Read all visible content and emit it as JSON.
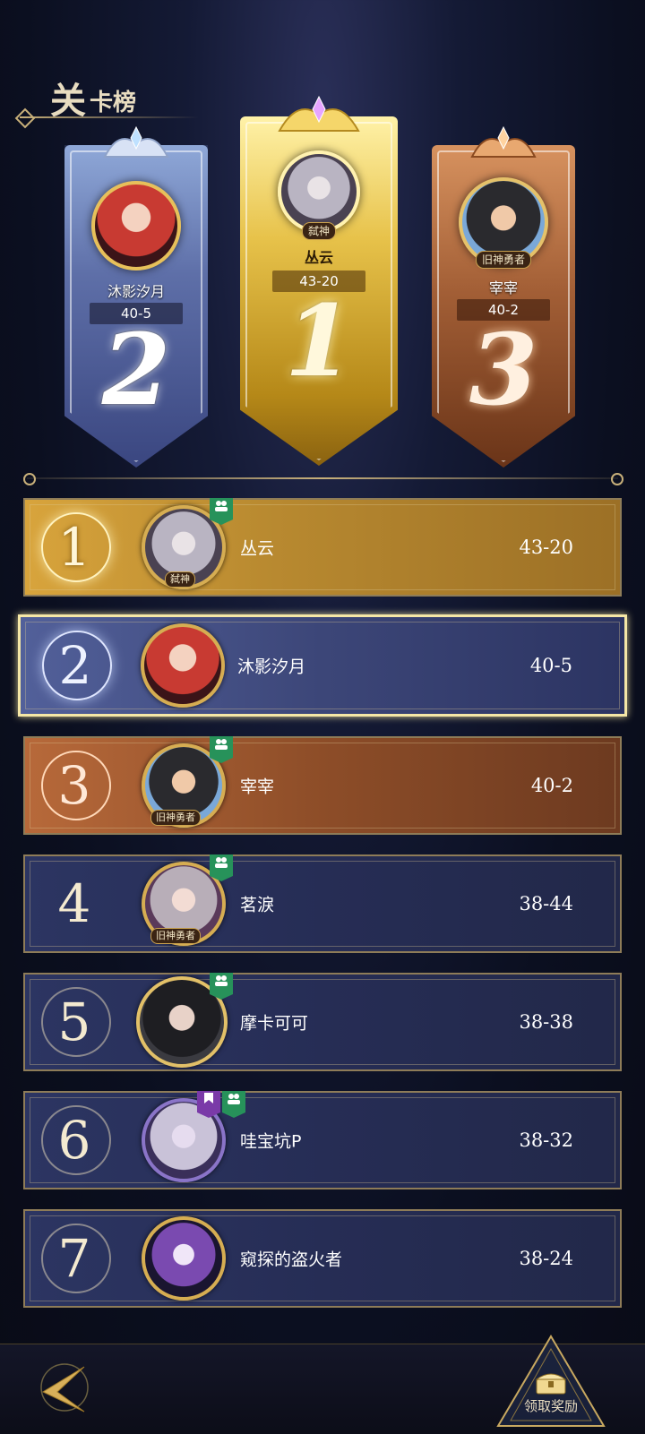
{
  "header": {
    "title_big": "关",
    "title_small": "卡榜"
  },
  "podium": [
    {
      "rank": "2",
      "name": "沐影汐月",
      "score": "40-5",
      "tag": ""
    },
    {
      "rank": "1",
      "name": "丛云",
      "score": "43-20",
      "tag": "弑神"
    },
    {
      "rank": "3",
      "name": "宰宰",
      "score": "40-2",
      "tag": "旧神勇者"
    }
  ],
  "rows": [
    {
      "rank": "1",
      "name": "丛云",
      "score": "43-20",
      "tag": "弑神",
      "badges": [
        "green"
      ]
    },
    {
      "rank": "2",
      "name": "沐影汐月",
      "score": "40-5",
      "tag": "",
      "badges": []
    },
    {
      "rank": "3",
      "name": "宰宰",
      "score": "40-2",
      "tag": "旧神勇者",
      "badges": [
        "green"
      ]
    },
    {
      "rank": "4",
      "name": "茗淚",
      "score": "38-44",
      "tag": "旧神勇者",
      "badges": [
        "green"
      ]
    },
    {
      "rank": "5",
      "name": "摩卡可可",
      "score": "38-38",
      "tag": "",
      "badges": [
        "green"
      ]
    },
    {
      "rank": "6",
      "name": "哇宝坑P",
      "score": "38-32",
      "tag": "",
      "badges": [
        "purple",
        "green"
      ]
    },
    {
      "rank": "7",
      "name": "窥探的盗火者",
      "score": "38-24",
      "tag": "",
      "badges": []
    }
  ],
  "footer": {
    "reward_label": "领取奖励"
  },
  "icons": {
    "back": "back-arrow-icon",
    "reward": "treasure-chest-icon",
    "group_badge": "group-icon",
    "purple_badge": "bookmark-icon"
  },
  "colors": {
    "gold": "#d8a43c",
    "silver_blue": "#52609a",
    "bronze": "#b7693a",
    "navy": "#2c3562",
    "highlight": "#f5e7a6",
    "badge_green": "#27925a",
    "badge_purple": "#7a3aa8"
  }
}
